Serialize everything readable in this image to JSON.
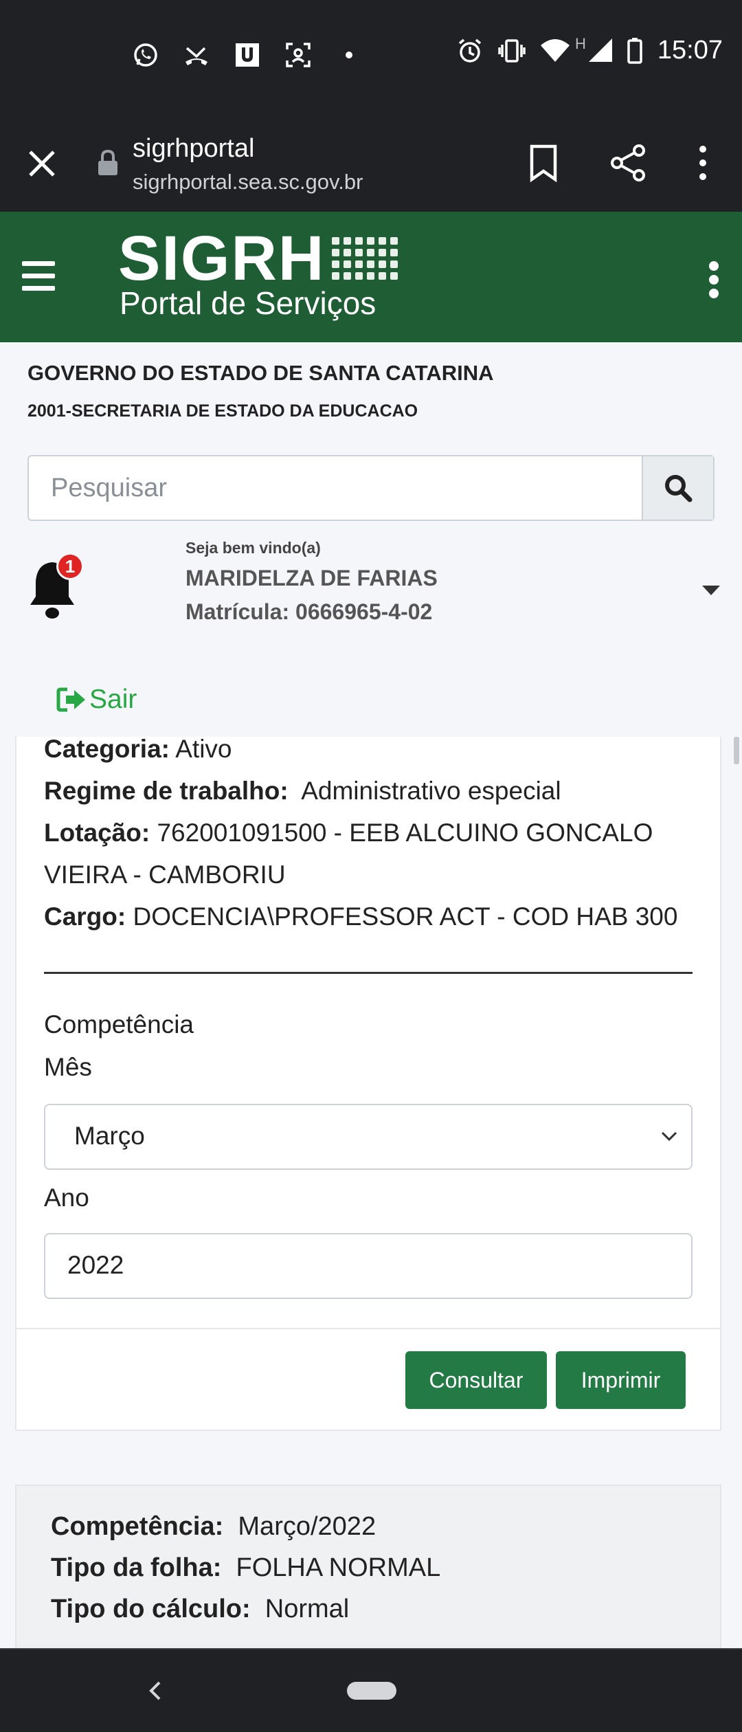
{
  "status_bar": {
    "time": "15:07",
    "network_label": "H",
    "notification_icons": [
      "whatsapp-icon",
      "missed-call-icon",
      "u-app-icon",
      "scan-icon",
      "dot-icon"
    ],
    "system_icons": [
      "alarm-icon",
      "vibrate-icon",
      "wifi-icon",
      "signal-icon",
      "battery-icon"
    ]
  },
  "browser": {
    "title": "sigrhportal",
    "url": "sigrhportal.sea.sc.gov.br"
  },
  "app_header": {
    "logo_main": "SIGRH",
    "logo_sub": "Portal de Serviços",
    "accent_color": "#1f5e35"
  },
  "org": {
    "government": "GOVERNO DO ESTADO DE SANTA CATARINA",
    "secretariat": "2001-SECRETARIA DE ESTADO DA EDUCACAO"
  },
  "search": {
    "placeholder": "Pesquisar"
  },
  "user": {
    "notification_count": "1",
    "welcome": "Seja bem vindo(a)",
    "name": "MARIDELZA DE FARIAS",
    "matricula": "Matrícula: 0666965-4-02",
    "logout_label": "Sair"
  },
  "employee_info": {
    "categoria_label": "Categoria:",
    "categoria_value": "Ativo",
    "regime_label": "Regime de trabalho:",
    "regime_value": "Administrativo especial",
    "lotacao_label": "Lotação:",
    "lotacao_value_line1": "762001091500 - EEB ALCUINO GONCALO",
    "lotacao_value_line2": "VIEIRA - CAMBORIU",
    "cargo_label": "Cargo:",
    "cargo_value": "DOCENCIA\\PROFESSOR ACT - COD HAB 300"
  },
  "form": {
    "competencia_label": "Competência",
    "mes_label": "Mês",
    "mes_value": "Março",
    "ano_label": "Ano",
    "ano_value": "2022",
    "consultar_label": "Consultar",
    "imprimir_label": "Imprimir",
    "button_color": "#237a45"
  },
  "result": {
    "competencia_label": "Competência:",
    "competencia_value": "Março/2022",
    "tipo_folha_label": "Tipo da folha:",
    "tipo_folha_value": "FOLHA NORMAL",
    "tipo_calculo_label": "Tipo do cálculo:",
    "tipo_calculo_value": "Normal"
  }
}
